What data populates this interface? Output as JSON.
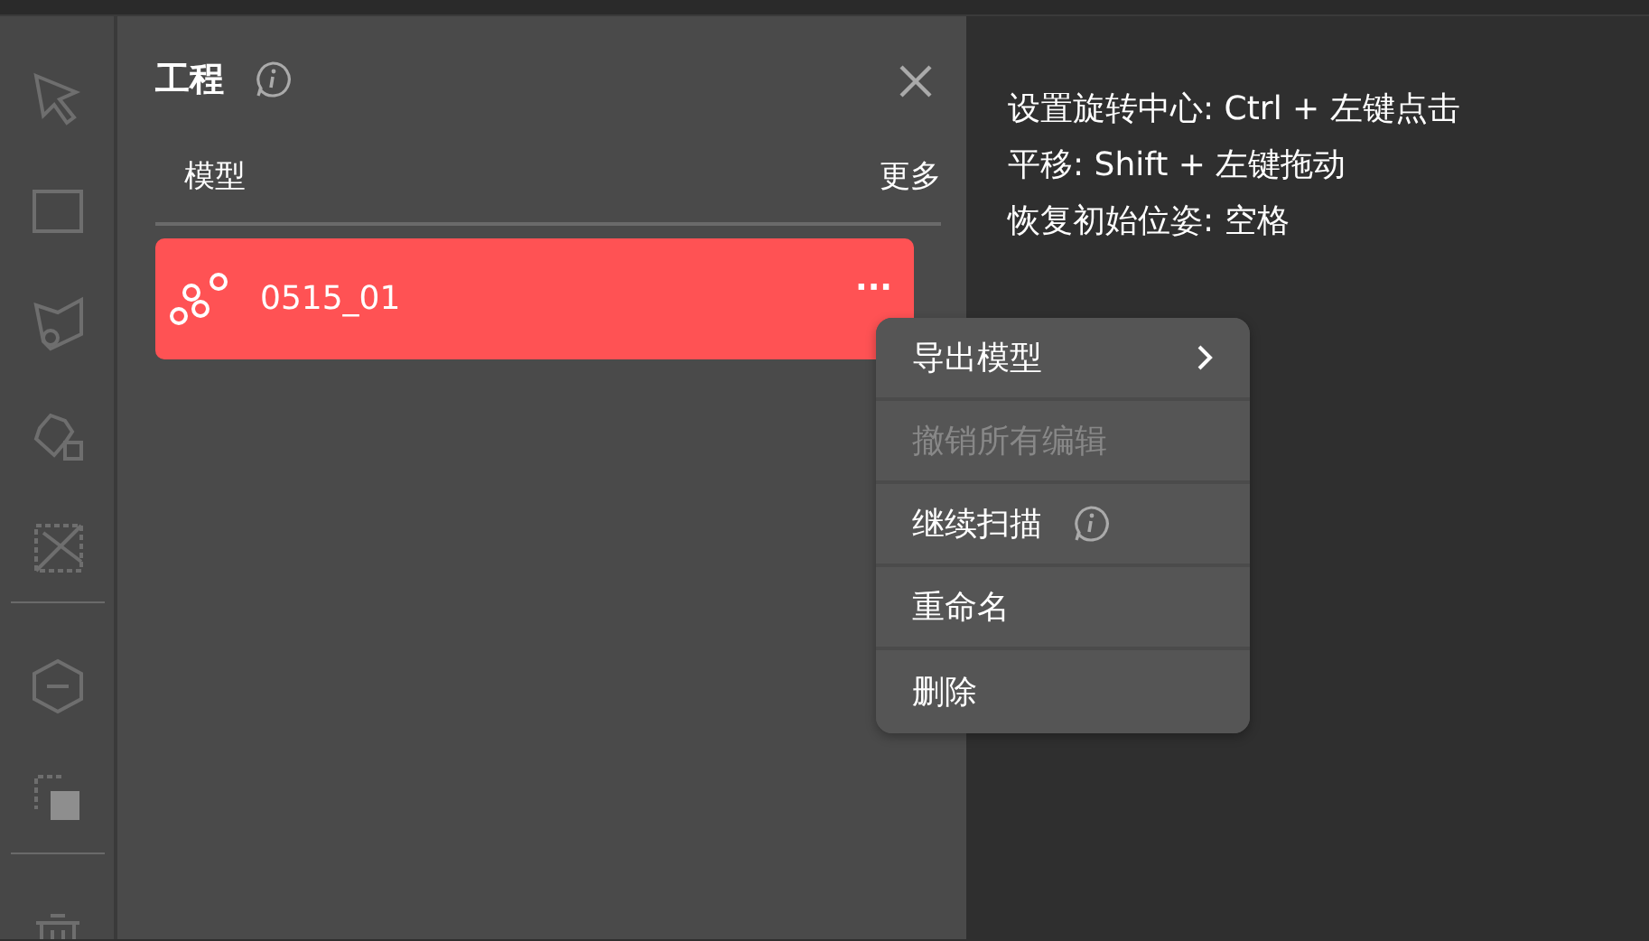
{
  "toolbar": {
    "tools": [
      {
        "kind": "cursor"
      },
      {
        "kind": "rect"
      },
      {
        "kind": "lasso"
      },
      {
        "kind": "poly"
      },
      {
        "kind": "diag"
      },
      {
        "kind": "divider"
      },
      {
        "kind": "hex"
      },
      {
        "kind": "copy"
      },
      {
        "kind": "divider"
      },
      {
        "kind": "trash"
      }
    ]
  },
  "panel": {
    "title": "工程",
    "tab_label": "模型",
    "more_label": "更多",
    "items": [
      {
        "name": "0515_01",
        "selected": true,
        "more": "···"
      }
    ]
  },
  "context_menu": [
    {
      "label": "导出模型",
      "disabled": false,
      "submenu": true,
      "info": false
    },
    {
      "label": "撤销所有编辑",
      "disabled": true,
      "submenu": false,
      "info": false
    },
    {
      "label": "继续扫描",
      "disabled": false,
      "submenu": false,
      "info": true
    },
    {
      "label": "重命名",
      "disabled": false,
      "submenu": false,
      "info": false
    },
    {
      "label": "删除",
      "disabled": false,
      "submenu": false,
      "info": false
    }
  ],
  "hints": [
    "设置旋转中心: Ctrl + 左键点击",
    "平移: Shift + 左键拖动",
    "恢复初始位姿: 空格"
  ]
}
